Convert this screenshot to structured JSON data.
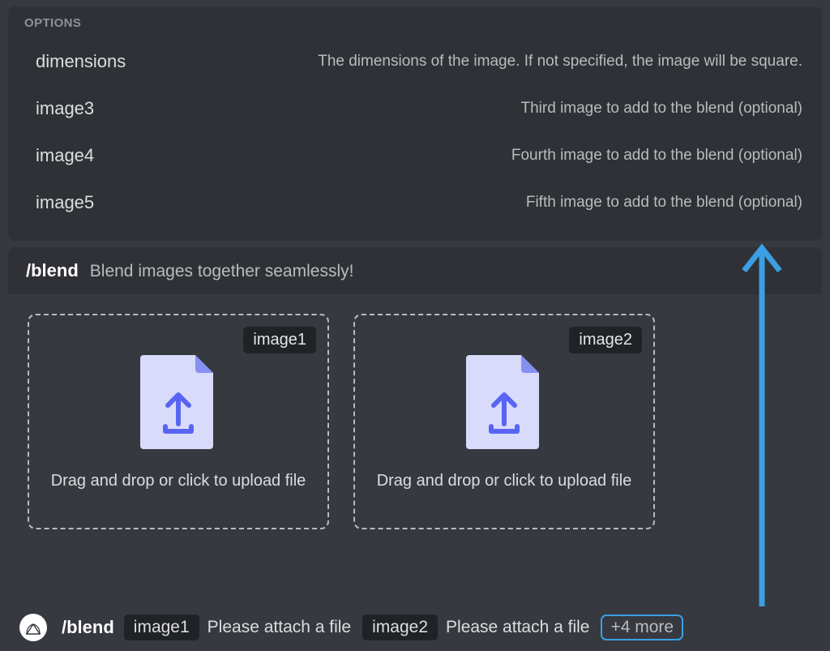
{
  "options": {
    "title": "OPTIONS",
    "rows": [
      {
        "name": "dimensions",
        "desc": "The dimensions of the image. If not specified, the image will be square."
      },
      {
        "name": "image3",
        "desc": "Third image to add to the blend (optional)"
      },
      {
        "name": "image4",
        "desc": "Fourth image to add to the blend (optional)"
      },
      {
        "name": "image5",
        "desc": "Fifth image to add to the blend (optional)"
      }
    ]
  },
  "command": {
    "name": "/blend",
    "desc": "Blend images together seamlessly!"
  },
  "uploads": [
    {
      "label": "image1",
      "prompt": "Drag and drop or click to upload file"
    },
    {
      "label": "image2",
      "prompt": "Drag and drop or click to upload file"
    }
  ],
  "inputbar": {
    "slash": "/blend",
    "params": [
      {
        "chip": "image1",
        "prompt": "Please attach a file"
      },
      {
        "chip": "image2",
        "prompt": "Please attach a file"
      }
    ],
    "more": "+4 more"
  },
  "colors": {
    "accent_blue": "#3b9fe5",
    "indigo": "#5865f2",
    "lilac": "#d9dbfb"
  }
}
